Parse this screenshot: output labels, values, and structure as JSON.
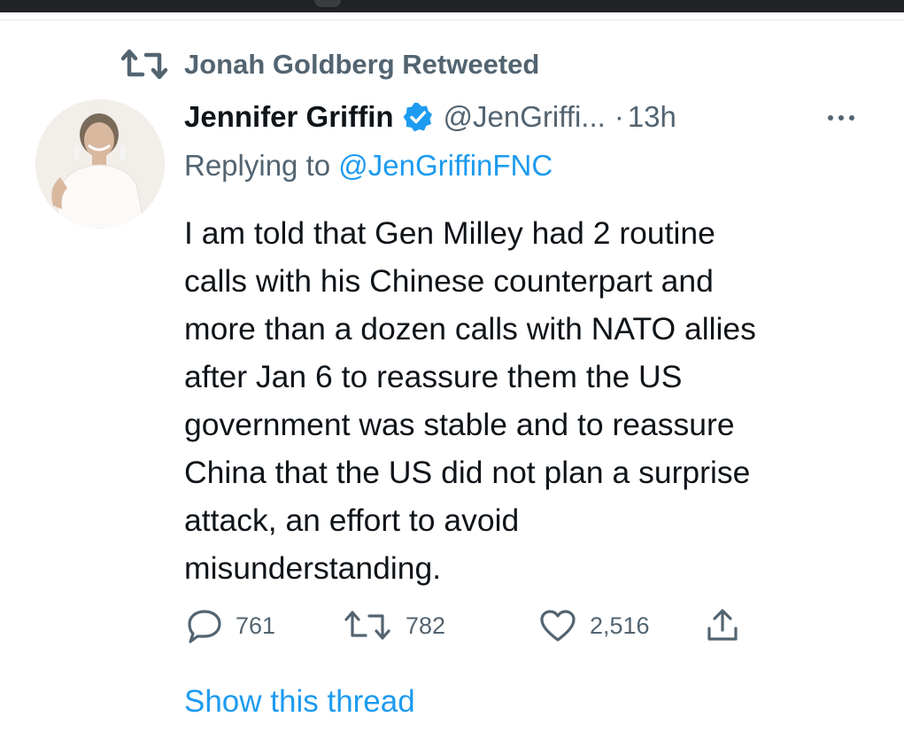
{
  "retweet_context": {
    "label": "Jonah Goldberg Retweeted",
    "icon": "retweet-icon"
  },
  "tweet": {
    "author_name": "Jennifer Griffin",
    "handle": "@JenGriffi...",
    "separator": "·",
    "timestamp": "13h",
    "verified": true,
    "replying_prefix": "Replying to ",
    "replying_to": "@JenGriffinFNC",
    "text_lines": [
      "I am told that Gen Milley had 2 routine",
      "calls with his Chinese counterpart and",
      "more than a dozen calls with NATO allies",
      "after Jan 6 to reassure them the US",
      "government was stable and to reassure",
      "China that the US did not plan a surprise",
      "attack, an effort to avoid",
      "misunderstanding."
    ]
  },
  "actions": {
    "reply_count": "761",
    "retweet_count": "782",
    "like_count": "2,516"
  },
  "show_thread": "Show this thread",
  "colors": {
    "text_primary": "#0f1419",
    "text_secondary": "#536471",
    "accent": "#1d9bf0"
  }
}
